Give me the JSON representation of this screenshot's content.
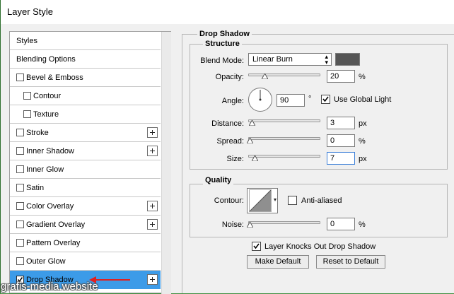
{
  "window": {
    "title": "Layer Style"
  },
  "sidebar": {
    "items": [
      {
        "label": "Styles",
        "checkbox": false,
        "plus": false,
        "indent": false
      },
      {
        "label": "Blending Options",
        "checkbox": false,
        "plus": false,
        "indent": false
      },
      {
        "label": "Bevel & Emboss",
        "checkbox": true,
        "checked": false,
        "plus": false,
        "indent": false
      },
      {
        "label": "Contour",
        "checkbox": true,
        "checked": false,
        "plus": false,
        "indent": true
      },
      {
        "label": "Texture",
        "checkbox": true,
        "checked": false,
        "plus": false,
        "indent": true
      },
      {
        "label": "Stroke",
        "checkbox": true,
        "checked": false,
        "plus": true,
        "indent": false
      },
      {
        "label": "Inner Shadow",
        "checkbox": true,
        "checked": false,
        "plus": true,
        "indent": false
      },
      {
        "label": "Inner Glow",
        "checkbox": true,
        "checked": false,
        "plus": false,
        "indent": false
      },
      {
        "label": "Satin",
        "checkbox": true,
        "checked": false,
        "plus": false,
        "indent": false
      },
      {
        "label": "Color Overlay",
        "checkbox": true,
        "checked": false,
        "plus": true,
        "indent": false
      },
      {
        "label": "Gradient Overlay",
        "checkbox": true,
        "checked": false,
        "plus": true,
        "indent": false
      },
      {
        "label": "Pattern Overlay",
        "checkbox": true,
        "checked": false,
        "plus": false,
        "indent": false
      },
      {
        "label": "Outer Glow",
        "checkbox": true,
        "checked": false,
        "plus": false,
        "indent": false
      },
      {
        "label": "Drop Shadow",
        "checkbox": true,
        "checked": true,
        "plus": true,
        "indent": false,
        "selected": true
      }
    ],
    "selected_color": "#3c9be8"
  },
  "drop_shadow": {
    "title": "Drop Shadow",
    "structure": {
      "title": "Structure",
      "blend_mode_label": "Blend Mode:",
      "blend_mode_value": "Linear Burn",
      "shadow_color": "#555555",
      "opacity_label": "Opacity:",
      "opacity_value": "20",
      "opacity_unit": "%",
      "opacity_level": 0.2,
      "angle_label": "Angle:",
      "angle_value": "90",
      "angle_unit": "°",
      "use_global_light_label": "Use Global Light",
      "use_global_light_checked": true,
      "distance_label": "Distance:",
      "distance_value": "3",
      "distance_unit": "px",
      "spread_label": "Spread:",
      "spread_value": "0",
      "spread_unit": "%",
      "size_label": "Size:",
      "size_value": "7",
      "size_unit": "px"
    },
    "quality": {
      "title": "Quality",
      "contour_label": "Contour:",
      "anti_aliased_label": "Anti-aliased",
      "anti_aliased_checked": false,
      "noise_label": "Noise:",
      "noise_value": "0",
      "noise_unit": "%"
    },
    "layer_knocks_out_label": "Layer Knocks Out Drop Shadow",
    "layer_knocks_out_checked": true,
    "make_default_label": "Make Default",
    "reset_default_label": "Reset to Default"
  },
  "watermark": "grafis-media.website"
}
